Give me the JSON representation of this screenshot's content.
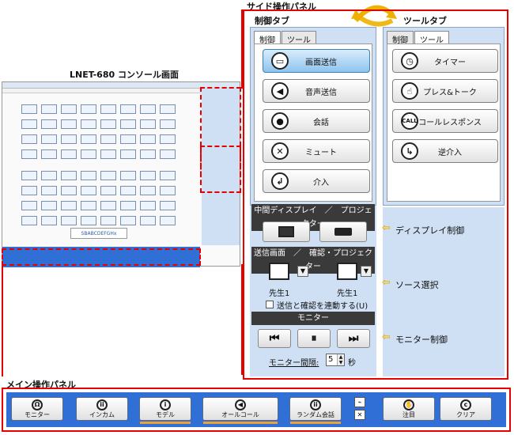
{
  "labels": {
    "side_panel": "サイド操作パネル",
    "control_tab": "制御タブ",
    "tool_tab": "ツールタブ",
    "console_title": "LNET-680 コンソール画面",
    "main_panel": "メイン操作パネル",
    "display_control": "ディスプレイ制御",
    "source_select": "ソース選択",
    "monitor_control": "モニター制御"
  },
  "control_panel": {
    "tabs": [
      "制御",
      "ツール"
    ],
    "buttons": [
      {
        "label": "画面送信",
        "icon": "monitor-icon"
      },
      {
        "label": "音声送信",
        "icon": "speaker-icon"
      },
      {
        "label": "会話",
        "icon": "chat-icon"
      },
      {
        "label": "ミュート",
        "icon": "mute-icon"
      },
      {
        "label": "介入",
        "icon": "intervene-icon"
      }
    ]
  },
  "tool_panel": {
    "tabs": [
      "制御",
      "ツール"
    ],
    "buttons": [
      {
        "label": "タイマー",
        "icon": "clock-icon"
      },
      {
        "label": "プレス&トーク",
        "icon": "press-talk-icon"
      },
      {
        "label": "コールレスポンス",
        "icon": "call-response-icon"
      },
      {
        "label": "逆介入",
        "icon": "reverse-intervene-icon"
      }
    ]
  },
  "display_section": {
    "header": "中間ディスプレイ　／　プロジェクター"
  },
  "source_section": {
    "header": "送信画面　／　確認・プロジェクター",
    "left_source": "先生1",
    "right_source": "先生1",
    "link_checkbox": "送信と確認を連動する(U)"
  },
  "monitor_section": {
    "header": "モニター",
    "interval_label": "モニター間隔:",
    "interval_value": "5",
    "interval_unit": "秒"
  },
  "main_buttons": [
    {
      "label": "モニター",
      "icon": "headphone-icon"
    },
    {
      "label": "インカム",
      "icon": "intercom-icon"
    },
    {
      "label": "モデル",
      "icon": "model-icon"
    },
    {
      "label": "オールコール",
      "icon": "all-call-icon"
    },
    {
      "label": "ランダム会話",
      "icon": "random-chat-icon"
    },
    {
      "label": "注目",
      "icon": "hand-icon"
    },
    {
      "label": "クリア",
      "icon": "clear-icon"
    }
  ],
  "colors": {
    "highlight": "#e60000",
    "panel_blue": "#2f6fd6",
    "header_dark": "#3a3a3a",
    "arrow": "#f0b000",
    "active": "#8ec4ef"
  }
}
